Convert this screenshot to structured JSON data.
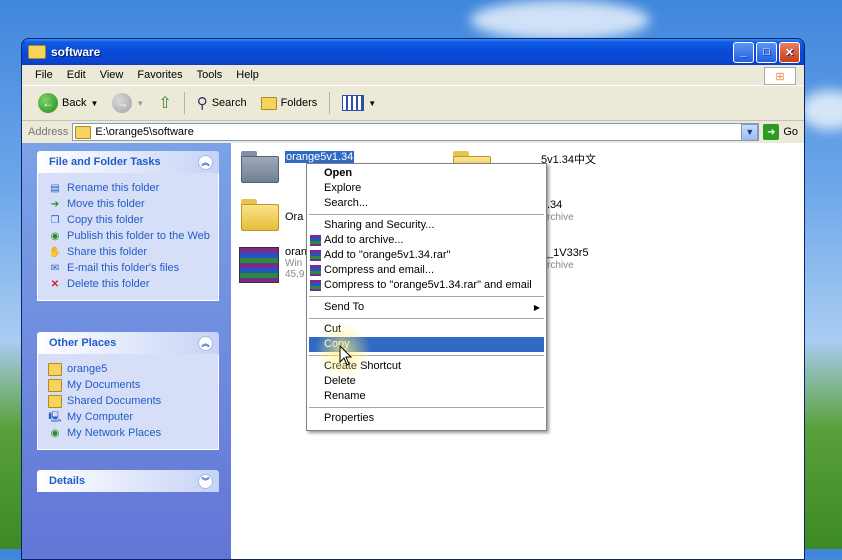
{
  "window": {
    "title": "software"
  },
  "menu": [
    "File",
    "Edit",
    "View",
    "Favorites",
    "Tools",
    "Help"
  ],
  "toolbar": {
    "back": "Back",
    "search": "Search",
    "folders": "Folders"
  },
  "address": {
    "label": "Address",
    "path": "E:\\orange5\\software",
    "go": "Go"
  },
  "file_tasks": {
    "title": "File and Folder Tasks",
    "items": [
      "Rename this folder",
      "Move this folder",
      "Copy this folder",
      "Publish this folder to the Web",
      "Share this folder",
      "E-mail this folder's files",
      "Delete this folder"
    ]
  },
  "other_places": {
    "title": "Other Places",
    "items": [
      "orange5",
      "My Documents",
      "Shared Documents",
      "My Computer",
      "My Network Places"
    ]
  },
  "details": {
    "title": "Details"
  },
  "files": [
    {
      "name": "orange5v1.34",
      "sub": ""
    },
    {
      "name": "5v1.34中文",
      "sub": ""
    },
    {
      "name": "Ora",
      "sub": ""
    },
    {
      "name": ".34",
      "sub": "rchive"
    },
    {
      "name": "oran",
      "sub": "Win"
    },
    {
      "name": "",
      "sub": "45,9"
    },
    {
      "name": "_1V33r5",
      "sub": "rchive"
    }
  ],
  "context_menu": {
    "open": "Open",
    "explore": "Explore",
    "search": "Search...",
    "sharing": "Sharing and Security...",
    "add_archive": "Add to archive...",
    "add_rar": "Add to \"orange5v1.34.rar\"",
    "compress_email": "Compress and email...",
    "compress_rar_email": "Compress to \"orange5v1.34.rar\" and email",
    "send_to": "Send To",
    "cut": "Cut",
    "copy": "Copy",
    "create_shortcut": "Create Shortcut",
    "delete": "Delete",
    "rename": "Rename",
    "properties": "Properties"
  }
}
